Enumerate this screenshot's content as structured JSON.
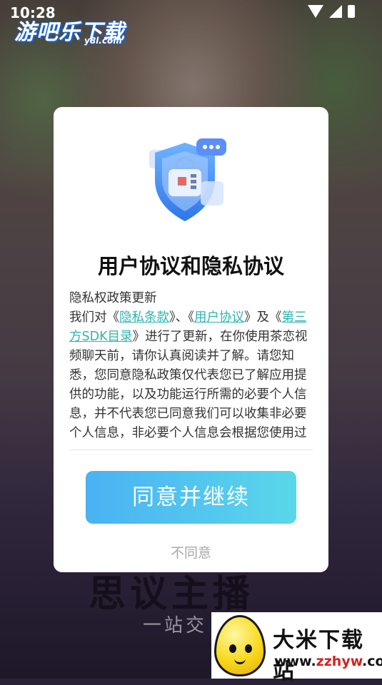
{
  "status_bar": {
    "time": "10:28"
  },
  "watermark_top": {
    "name": "游吧乐下载",
    "sub": "y8l.com"
  },
  "background_text": {
    "title": "思议主播",
    "subtitle": "一站交"
  },
  "dialog": {
    "title": "用户协议和隐私协议",
    "body": {
      "heading": "隐私权政策更新",
      "p1": "我们对",
      "q_open_1": "《",
      "link_privacy": "隐私条款",
      "q_close_1": "》、",
      "q_open_2": "《",
      "link_user": "用户协议",
      "q_close_2": "》及",
      "q_open_3": "《",
      "link_sdk": "第三方SDK目录",
      "q_close_3": "》",
      "p2": "进行了更新，在你使用茶恋视频聊天前，请你认真阅读并了解。请您知悉，您同意隐私政策仅代表您已了解应用提供的功能，以及功能运行所需的必要个人信息，并不代表您已同意我们可以收集非必要个人信息，非必要个人信息会根据您使用过程中的授权情况单独征求您的同意。"
    },
    "agree_label": "同意并继续",
    "disagree_label": "不同意",
    "accent_link": "#2db4b0",
    "button_gradient": [
      "#49b2f3",
      "#5ad7ea"
    ]
  },
  "watermark_bottom": {
    "name": "大米下载站",
    "url_prefix": "www.",
    "url_main": "zzhyw",
    "url_suffix": ".com"
  },
  "icons": [
    "wifi-icon",
    "signal-icon",
    "battery-icon",
    "shield-icon",
    "mascot-icon"
  ]
}
